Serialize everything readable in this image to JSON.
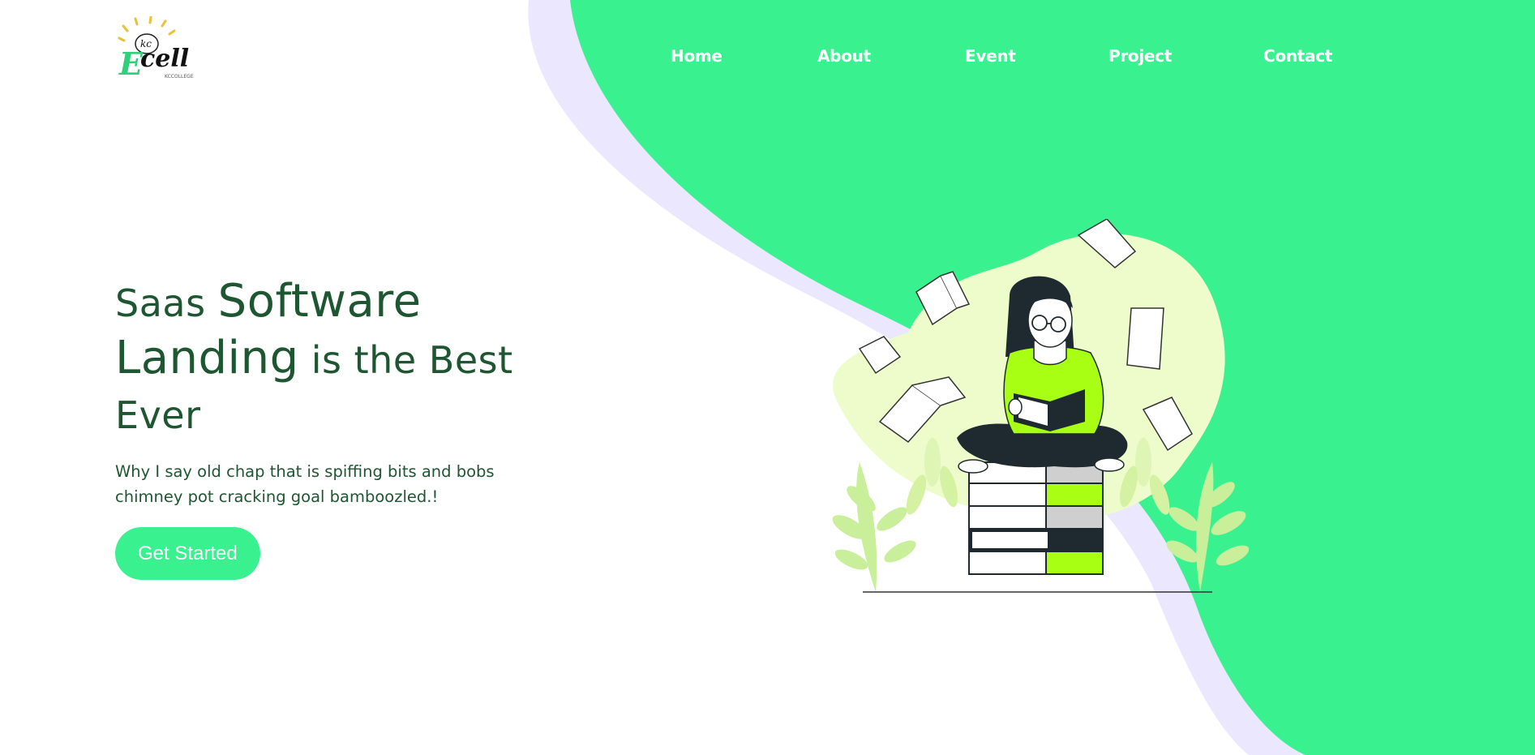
{
  "brand": {
    "logo_text": "Ecell",
    "logo_prefix": "kc",
    "logo_tagline": "KCCOLLEGE"
  },
  "nav": {
    "items": [
      {
        "label": "Home"
      },
      {
        "label": "About"
      },
      {
        "label": "Event"
      },
      {
        "label": "Project"
      },
      {
        "label": "Contact"
      }
    ]
  },
  "hero": {
    "title_part1": "Saas ",
    "title_part2": "Software",
    "title_part3": "Landing",
    "title_part4": " is the Best",
    "title_part5": "Ever",
    "subtitle": "Why I say old chap that is spiffing bits and bobs chimney pot cracking goal bamboozled.!",
    "cta_label": "Get Started"
  },
  "colors": {
    "accent_green": "#39f28f",
    "heading_dark_green": "#1e5631",
    "lavender_shadow": "#ebe7ff",
    "illustration_lime": "#a8ff14",
    "illustration_blob": "#eefccc",
    "illustration_dark": "#1f2a30"
  },
  "icons": {
    "logo": "ecell-lightbulb-logo",
    "illustration": "girl-reading-on-books-illustration"
  }
}
